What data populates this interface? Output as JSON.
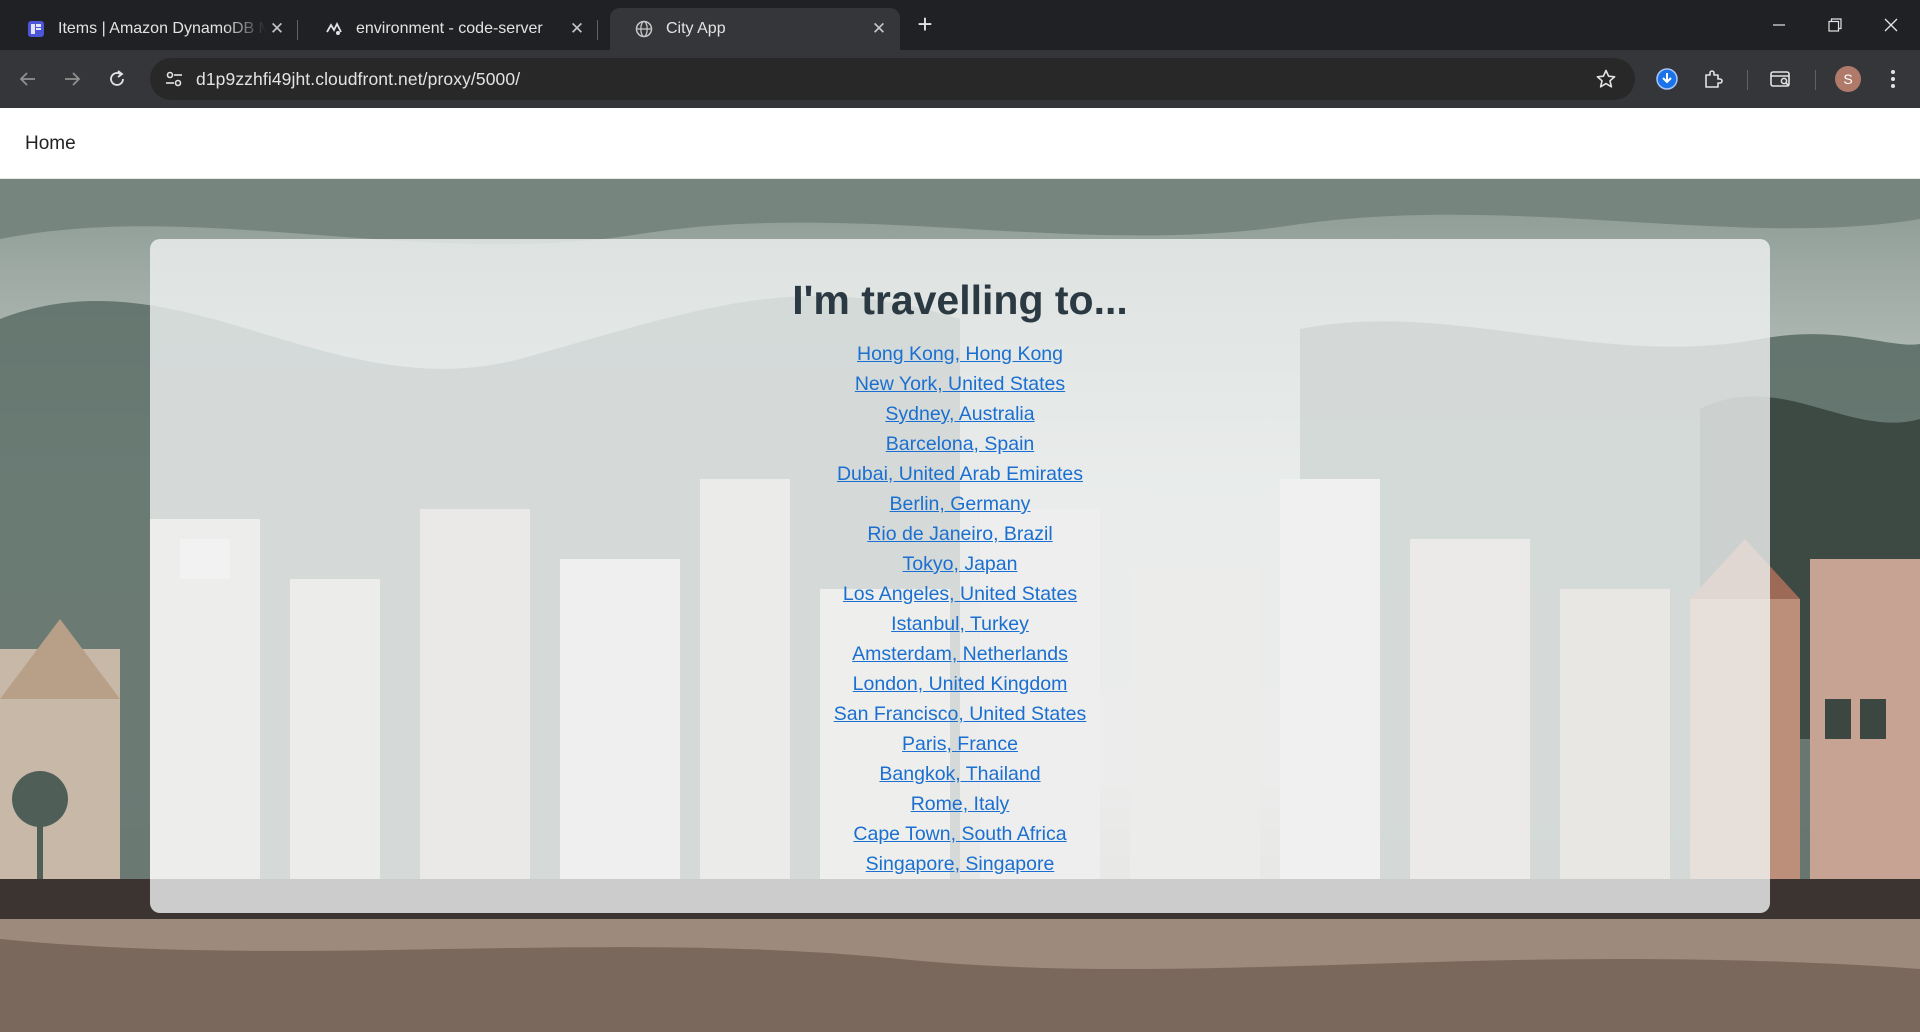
{
  "browser": {
    "tabs": [
      {
        "title": "Items | Amazon DynamoDB Ma",
        "icon": "dynamodb-icon",
        "active": false
      },
      {
        "title": "environment - code-server",
        "icon": "code-server-icon",
        "active": false
      },
      {
        "title": "City App",
        "icon": "globe-icon",
        "active": true
      }
    ],
    "url": "d1p9zzhfi49jht.cloudfront.net/proxy/5000/",
    "profile_initial": "S"
  },
  "app": {
    "nav_home": "Home",
    "heading": "I'm travelling to...",
    "cities": [
      "Hong Kong, Hong Kong",
      "New York, United States",
      "Sydney, Australia",
      "Barcelona, Spain",
      "Dubai, United Arab Emirates",
      "Berlin, Germany",
      "Rio de Janeiro, Brazil",
      "Tokyo, Japan",
      "Los Angeles, United States",
      "Istanbul, Turkey",
      "Amsterdam, Netherlands",
      "London, United Kingdom",
      "San Francisco, United States",
      "Paris, France",
      "Bangkok, Thailand",
      "Rome, Italy",
      "Cape Town, South Africa",
      "Singapore, Singapore"
    ]
  },
  "colors": {
    "link": "#1a6fd0",
    "heading": "#2b3a42",
    "browser_frame": "#202124",
    "toolbar": "#35363a"
  }
}
